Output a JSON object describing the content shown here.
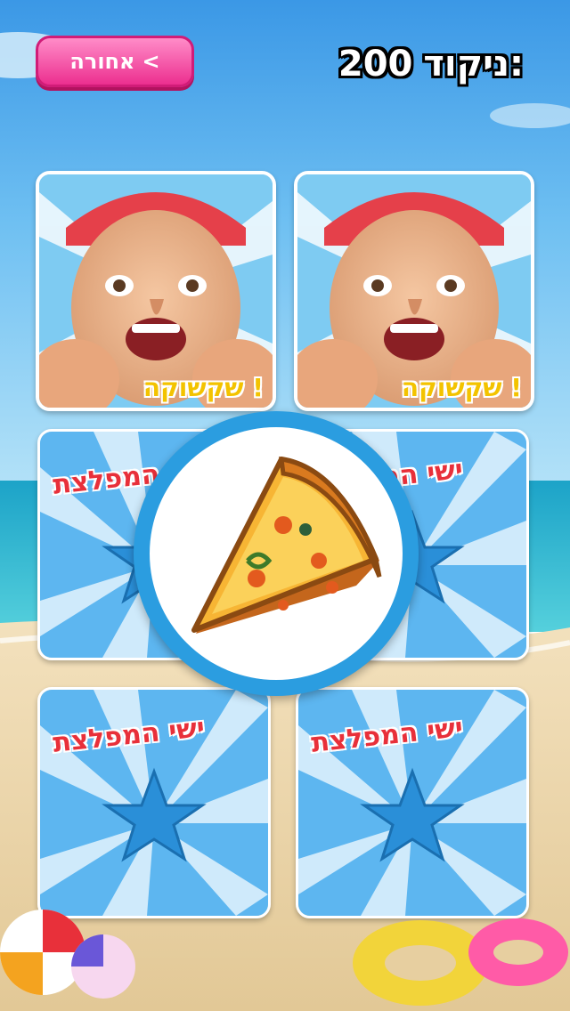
{
  "header": {
    "back_label": "אחורה",
    "back_arrow": "<",
    "score_label": "ניקוד:",
    "score_value": "200"
  },
  "game": {
    "face_card_caption": "שקשוקה !",
    "card_back_title": "ישי המפלצת",
    "revealed_item_icon": "pizza-icon"
  },
  "colors": {
    "sky": "#3d9fe8",
    "button_pink": "#ec2f8f",
    "swirl_blue": "#5db6f0",
    "zoom_ring": "#2b9de0"
  }
}
